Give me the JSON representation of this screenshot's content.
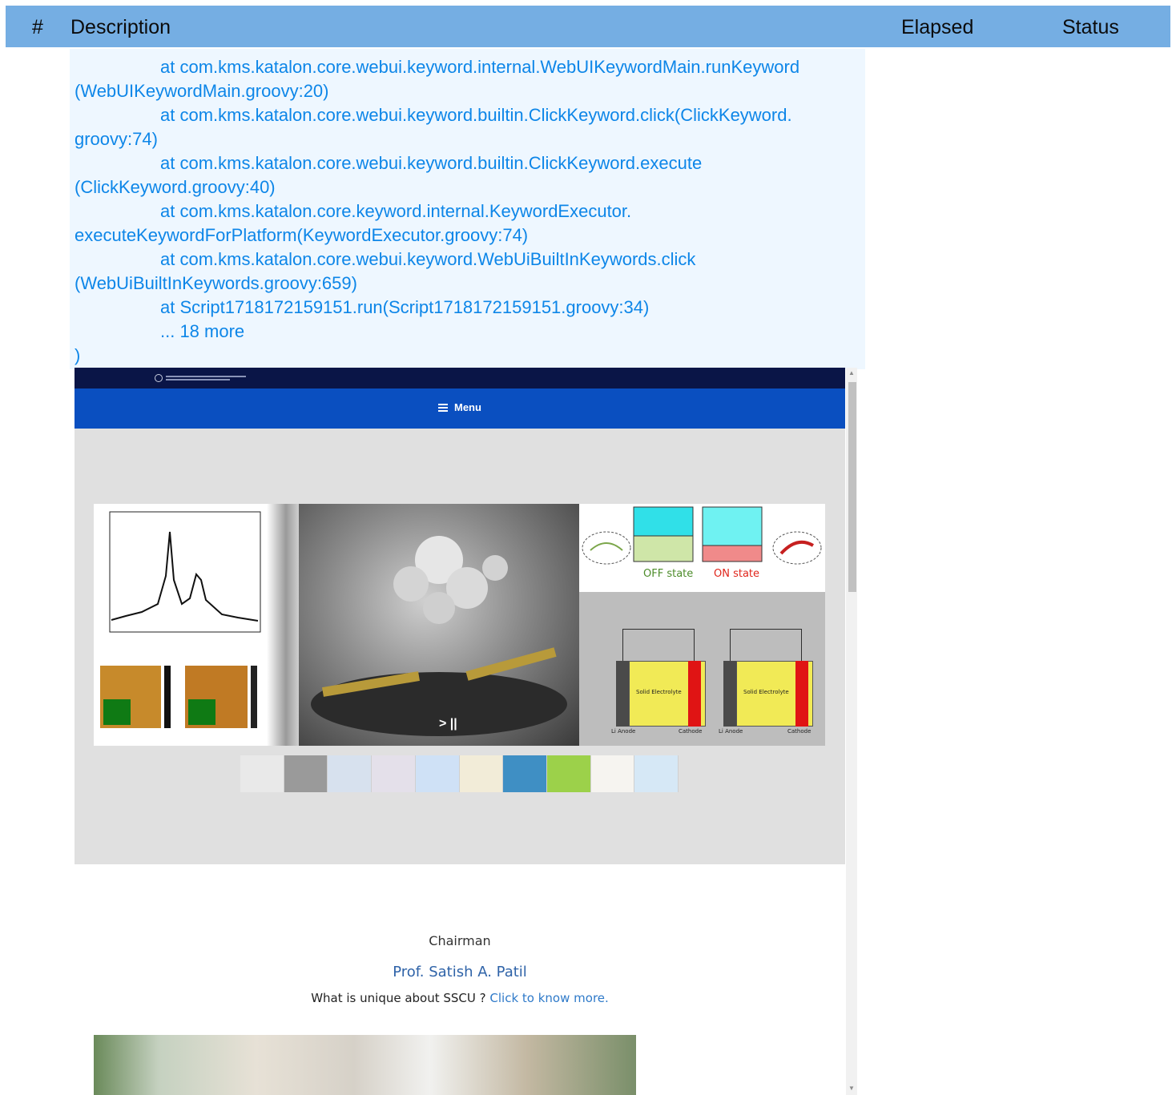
{
  "report_header": {
    "number": "#",
    "description": "Description",
    "elapsed": "Elapsed",
    "status": "Status"
  },
  "log": {
    "lines": [
      "at com.kms.katalon.core.webui.keyword.internal.WebUIKeywordMain.runKeyword",
      "(WebUIKeywordMain.groovy:20)",
      "at com.kms.katalon.core.webui.keyword.builtin.ClickKeyword.click(ClickKeyword.",
      "groovy:74)",
      "at com.kms.katalon.core.webui.keyword.builtin.ClickKeyword.execute",
      "(ClickKeyword.groovy:40)",
      "at com.kms.katalon.core.keyword.internal.KeywordExecutor.",
      "executeKeywordForPlatform(KeywordExecutor.groovy:74)",
      "at com.kms.katalon.core.webui.keyword.WebUiBuiltInKeywords.click",
      "(WebUiBuiltInKeywords.groovy:659)",
      "at Script1718172159151.run(Script1718172159151.groovy:34)",
      "... 18 more",
      ")"
    ]
  },
  "screenshot": {
    "menu_label": "Menu",
    "slide": {
      "off_state": "OFF state",
      "on_state": "ON state",
      "solid_electrolyte": "Solid Electrolyte",
      "li_anode": "Li Anode",
      "cathode": "Cathode",
      "play_control": "> ||"
    },
    "chairman_label": "Chairman",
    "chairman_name": "Prof. Satish A. Patil",
    "unique_prefix": "What is unique about SSCU ?",
    "unique_link": "Click to know more."
  },
  "colors": {
    "header_bg": "#75aee3",
    "log_text": "#0d86e8",
    "log_bg": "#eef7ff",
    "site_topbar": "#0a1547",
    "site_menubar": "#0a4fc0"
  }
}
